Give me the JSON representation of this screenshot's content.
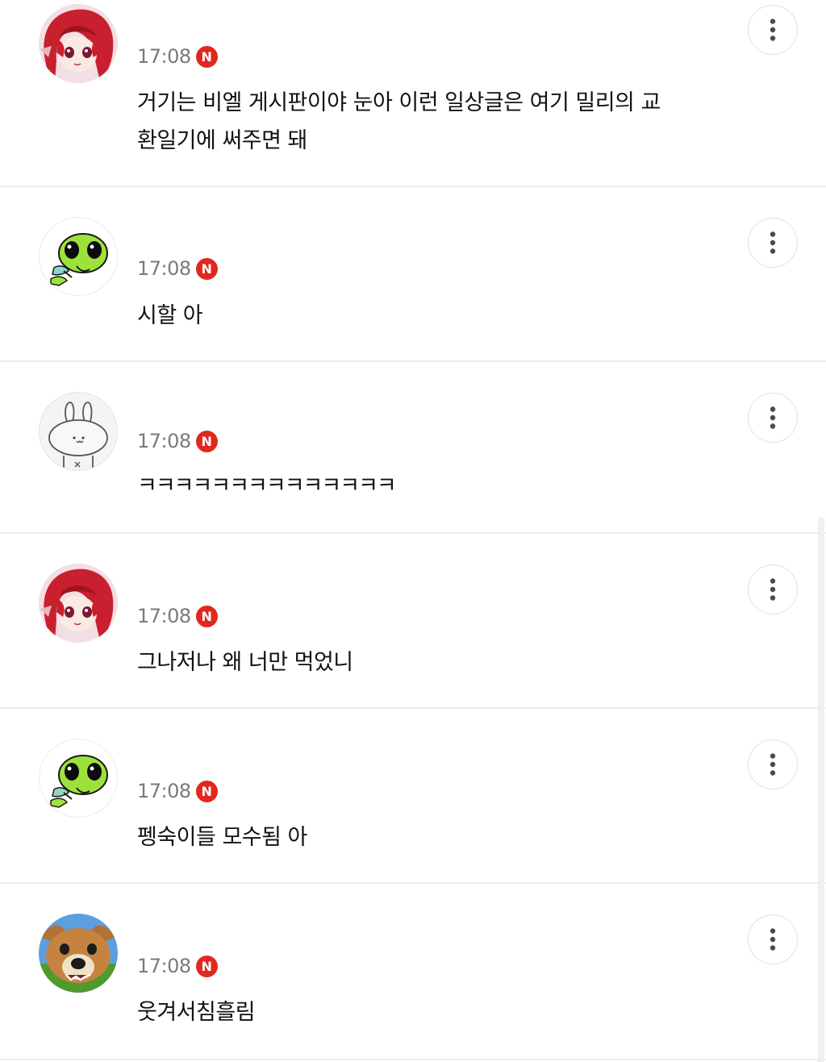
{
  "comments": [
    {
      "avatar": "red-hair-anime-girl",
      "time": "17:08",
      "badge": "N",
      "text": "거기는 비엘 게시판이야 눈아 이런 일상글은 여기 밀리의 교환일기에 써주면 돼",
      "more_icon": "vertical-dots-icon"
    },
    {
      "avatar": "green-alien-frog",
      "time": "17:08",
      "badge": "N",
      "text": "시할 아",
      "more_icon": "vertical-dots-icon"
    },
    {
      "avatar": "white-bunny-sketch",
      "time": "17:08",
      "badge": "N",
      "text": "ㅋㅋㅋㅋㅋㅋㅋㅋㅋㅋㅋㅋㅋㅋ",
      "more_icon": "vertical-dots-icon"
    },
    {
      "avatar": "red-hair-anime-girl",
      "time": "17:08",
      "badge": "N",
      "text": "그나저나 왜 너만 먹었니",
      "more_icon": "vertical-dots-icon"
    },
    {
      "avatar": "green-alien-frog",
      "time": "17:08",
      "badge": "N",
      "text": "펭숙이들 모수됨 아",
      "more_icon": "vertical-dots-icon"
    },
    {
      "avatar": "dog-photo",
      "time": "17:08",
      "badge": "N",
      "text": "웃겨서침흘림",
      "more_icon": "vertical-dots-icon"
    }
  ],
  "colors": {
    "badge": "#e0281e",
    "time": "#7a7a7a",
    "divider": "#ececec"
  }
}
